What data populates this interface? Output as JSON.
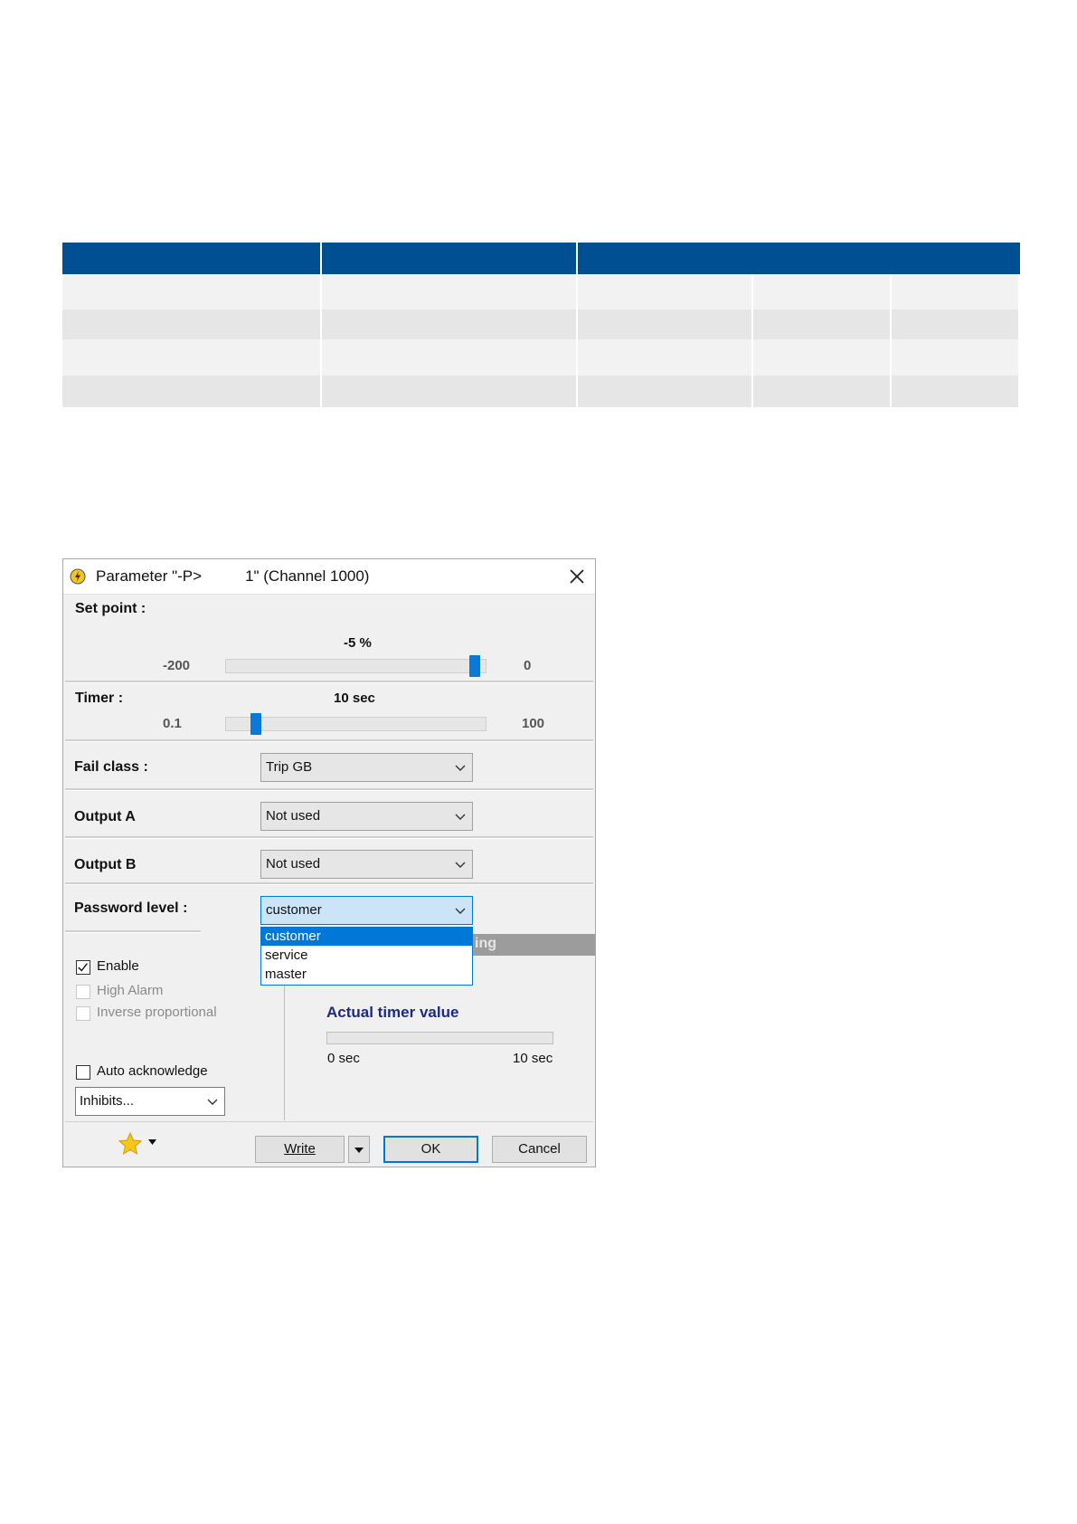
{
  "dialog": {
    "title_left": "Parameter \"-P>",
    "title_right": "1\" (Channel 1000)"
  },
  "set_point": {
    "label": "Set point :",
    "value": "-5 %",
    "min": "-200",
    "max": "0",
    "level": 0.975
  },
  "timer": {
    "label": "Timer :",
    "value": "10 sec",
    "min": "0.1",
    "max": "100",
    "level": 0.1
  },
  "fail_class": {
    "label": "Fail class :",
    "value": "Trip GB"
  },
  "output_a": {
    "label": "Output A",
    "value": "Not used"
  },
  "output_b": {
    "label": "Output B",
    "value": "Not used"
  },
  "password_level": {
    "label": "Password level :",
    "value": "customer",
    "options": [
      "customer",
      "service",
      "master"
    ]
  },
  "partial_header": "ing",
  "checkboxes": {
    "enable": {
      "label": "Enable",
      "checked": true
    },
    "high_alarm": {
      "label": "High Alarm",
      "checked": false
    },
    "inverse_proportional": {
      "label": "Inverse proportional",
      "checked": false
    },
    "auto_acknowledge": {
      "label": "Auto acknowledge",
      "checked": false
    }
  },
  "inhibits": {
    "value": "Inhibits..."
  },
  "actual_timer": {
    "title": "Actual timer value",
    "min_label": "0 sec",
    "max_label": "10 sec"
  },
  "buttons": {
    "write": "Write",
    "ok": "OK",
    "cancel": "Cancel"
  },
  "colors": {
    "table_header": "#004f93",
    "accent": "#0078d7",
    "timer_title": "#1a2a8c"
  }
}
